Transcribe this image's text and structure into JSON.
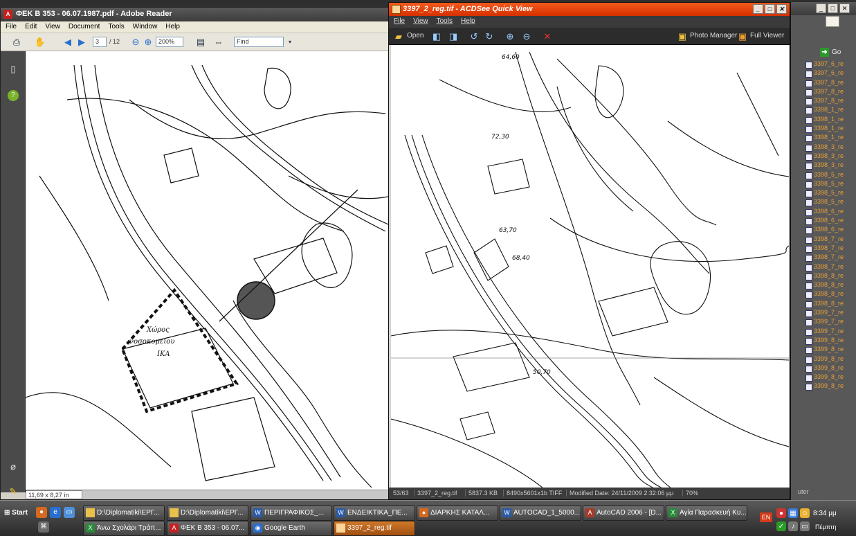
{
  "reader": {
    "title": "ΦΕΚ Β 353 - 06.07.1987.pdf - Adobe Reader",
    "menu": [
      "File",
      "Edit",
      "View",
      "Document",
      "Tools",
      "Window",
      "Help"
    ],
    "page_current": "3",
    "page_total": "/ 12",
    "zoom": "200%",
    "find_placeholder": "Find",
    "page_size": "11,69 x 8,27 in",
    "map_label_1": "Χώρος",
    "map_label_2": "νοσοκομείου",
    "map_label_3": "ΙΚΑ"
  },
  "acdsee": {
    "title": "3397_2_reg.tif - ACDSee Quick View",
    "menu": [
      "File",
      "View",
      "Tools",
      "Help"
    ],
    "open_label": "Open",
    "photo_manager_label": "Photo Manager",
    "full_viewer_label": "Full Viewer",
    "status": {
      "index": "53/63",
      "filename": "3397_2_reg.tif",
      "size": "5837.3 KB",
      "dims": "8490x5601x1b TIFF",
      "modified": "Modified Date: 24/11/2009 2:32:06 μμ",
      "zoom": "70%"
    },
    "elev_1": "64,60",
    "elev_2": "72,30",
    "elev_3": "63,70",
    "elev_4": "68,40",
    "elev_5": "50,70"
  },
  "explorer": {
    "go_label": "Go",
    "files": [
      "3397_6_re",
      "3397_6_re",
      "3397_8_re",
      "3397_8_re",
      "3397_8_re",
      "3398_1_re",
      "3398_1_re",
      "3398_1_re",
      "3398_1_re",
      "3398_3_re",
      "3398_3_re",
      "3398_3_re",
      "3398_5_re",
      "3398_5_re",
      "3398_5_re",
      "3398_5_re",
      "3398_6_re",
      "3398_6_re",
      "3398_6_re",
      "3398_7_re",
      "3398_7_re",
      "3398_7_re",
      "3398_7_re",
      "3398_8_re",
      "3398_8_re",
      "3398_8_re",
      "3398_8_re",
      "3399_7_re",
      "3399_7_re",
      "3399_7_re",
      "3399_8_re",
      "3399_8_re",
      "3399_8_re",
      "3399_8_re",
      "3399_8_re",
      "3399_8_re"
    ],
    "status_tail": "uter"
  },
  "taskbar": {
    "start_label": "Start",
    "tasks_row1": [
      "D:\\Diplomatiki\\ΕΡΓ...",
      "D:\\Diplomatiki\\ΕΡΓ...",
      "ΠΕΡΙΓΡΑΦΙΚΟΣ_...",
      "ΕΝΔΕΙΚΤΙΚΑ_ΠΕ...",
      "ΔΙΑΡΚΗΣ ΚΑΤΑΛ...",
      "AUTOCAD_1_5000...",
      "AutoCAD 2006 - [D...",
      "Αγία Παρασκευή Κυ..."
    ],
    "tasks_row2": [
      "Άνω Σχολάρι Τράπ...",
      "ΦΕΚ Β 353 - 06.07...",
      "Google Earth",
      "3397_2_reg.tif"
    ],
    "lang": "EN",
    "clock": "8:34 μμ",
    "day": "Πέμπτη"
  }
}
